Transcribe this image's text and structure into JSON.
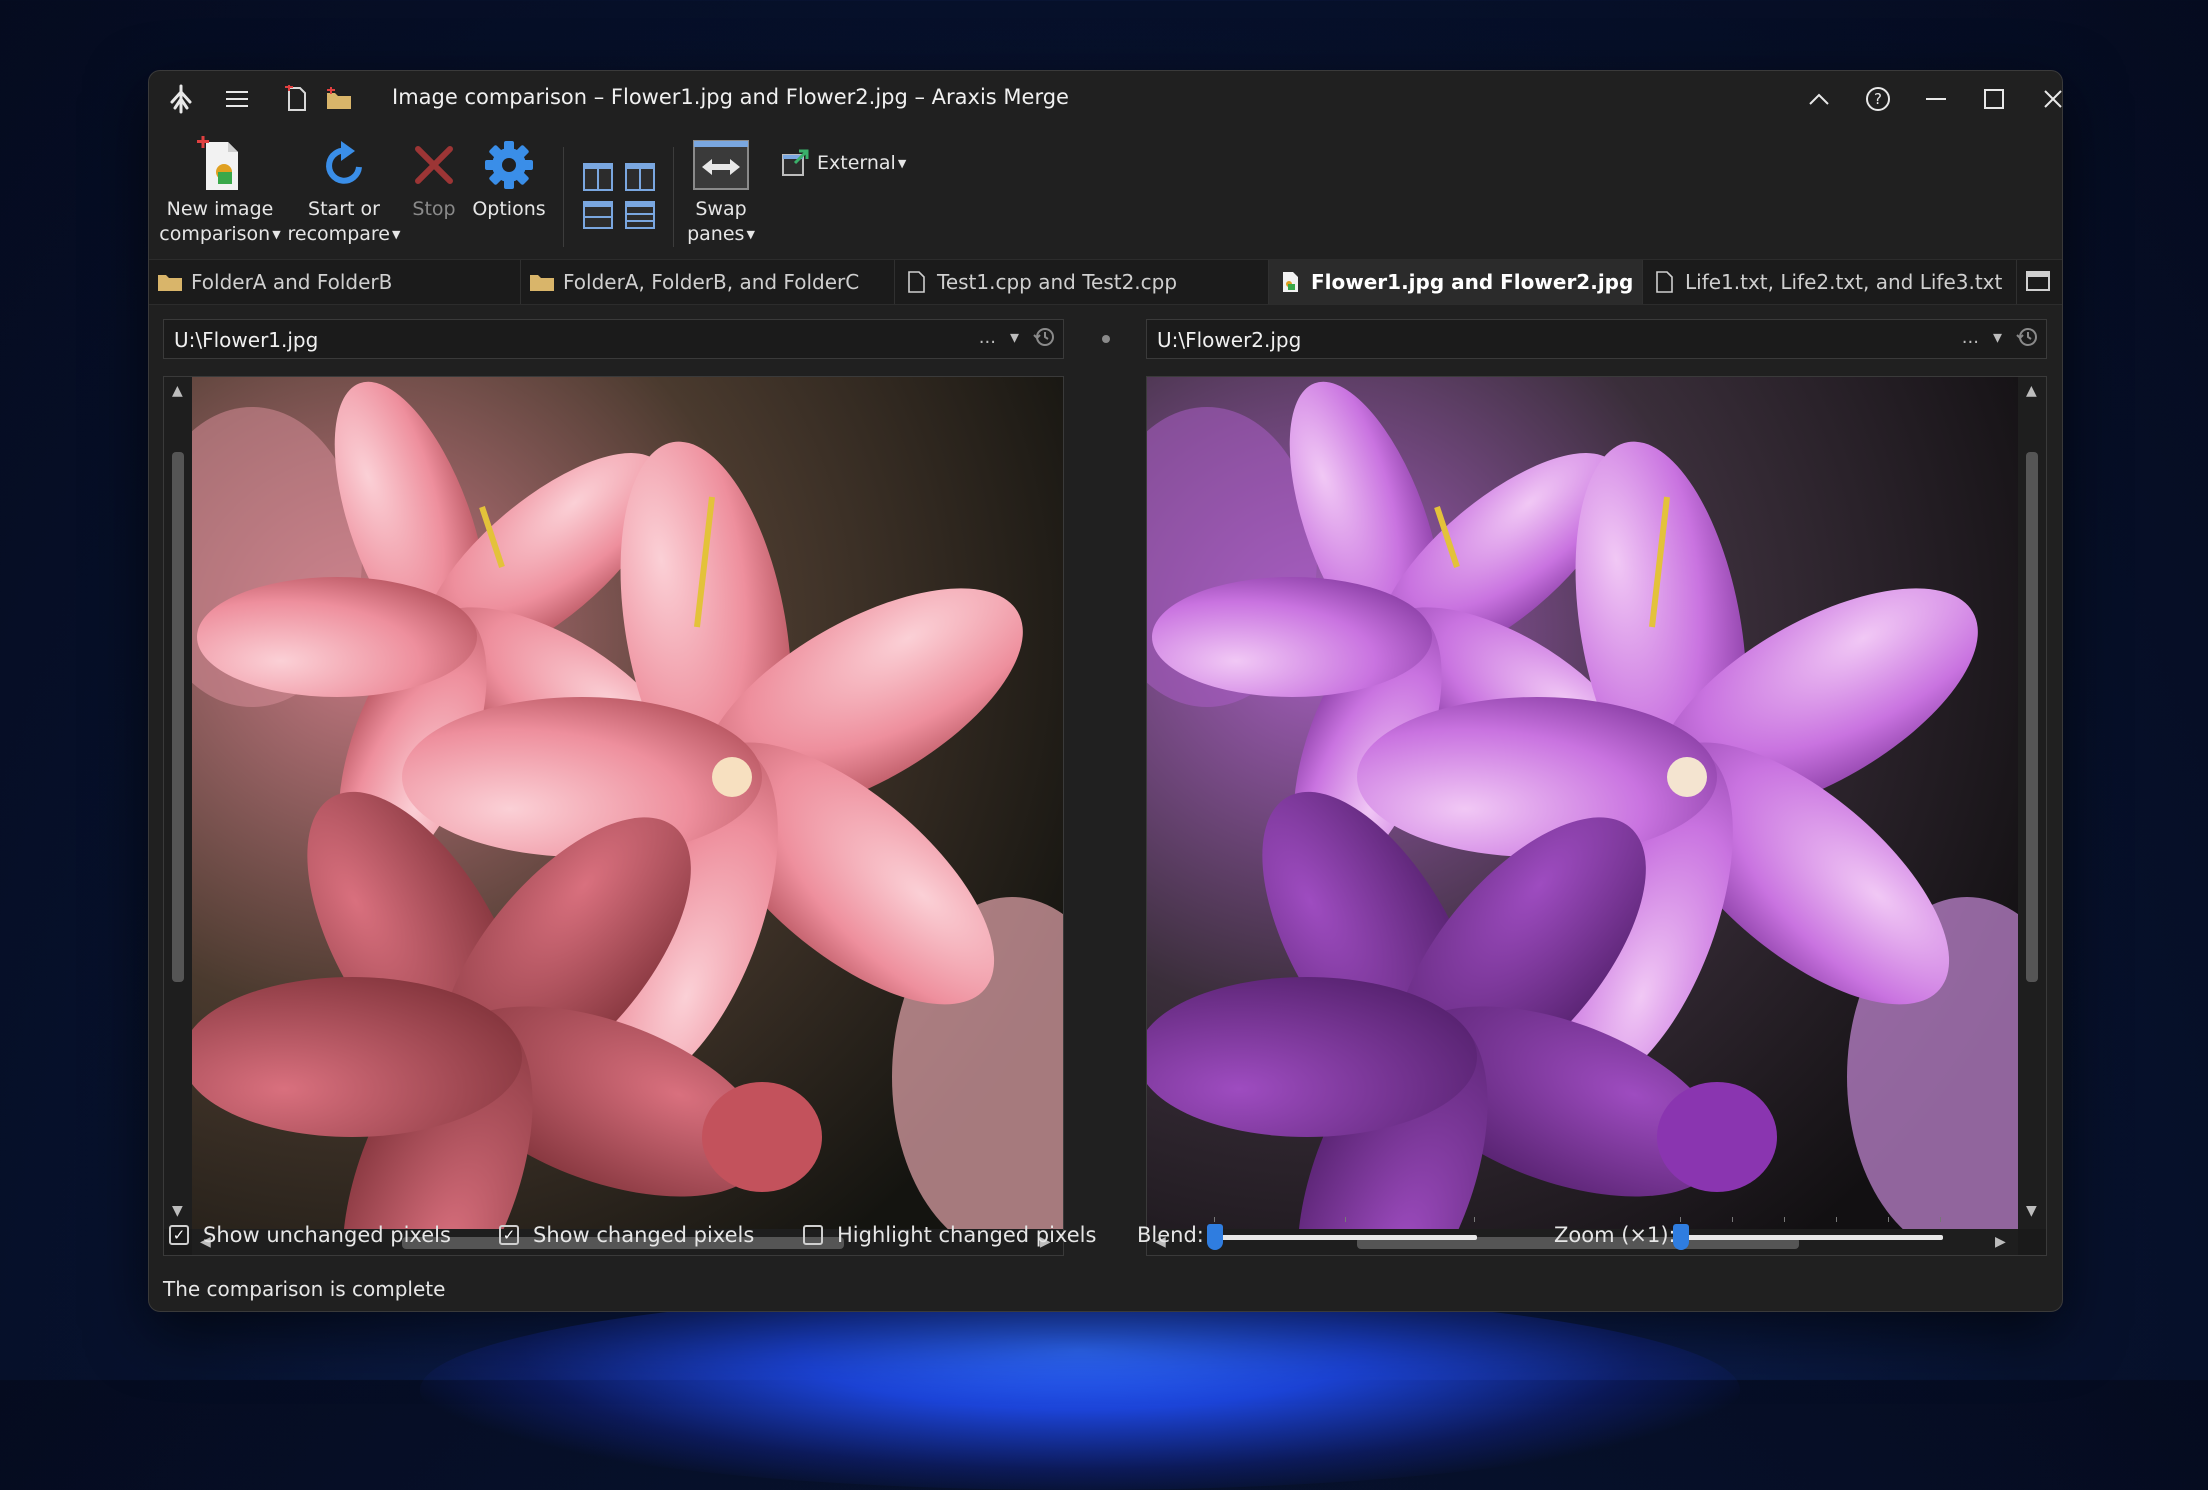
{
  "window": {
    "title": "Image comparison – Flower1.jpg and Flower2.jpg – Araxis Merge"
  },
  "titlebar_icons": [
    "app-logo-icon",
    "menu-icon",
    "new-file-icon",
    "open-folder-icon"
  ],
  "window_controls": [
    "collapse-ribbon-icon",
    "help-icon",
    "minimize-icon",
    "maximize-icon",
    "close-icon"
  ],
  "ribbon": {
    "new_image_comparison": {
      "line1": "New image",
      "line2": "comparison"
    },
    "start_or_recompare": {
      "line1": "Start or",
      "line2": "recompare"
    },
    "stop": "Stop",
    "options": "Options",
    "swap_panes": {
      "line1": "Swap",
      "line2": "panes"
    },
    "external": "External"
  },
  "tabs": [
    {
      "label": "FolderA and FolderB",
      "icon": "folder-icon",
      "active": false
    },
    {
      "label": "FolderA, FolderB, and FolderC",
      "icon": "folder-icon",
      "active": false
    },
    {
      "label": "Test1.cpp and Test2.cpp",
      "icon": "file-icon",
      "active": false
    },
    {
      "label": "Flower1.jpg and Flower2.jpg",
      "icon": "image-file-icon",
      "active": true
    },
    {
      "label": "Life1.txt, Life2.txt, and Life3.txt",
      "icon": "file-icon",
      "active": false
    }
  ],
  "left_pane": {
    "path": "U:\\Flower1.jpg",
    "tint": "#e88aa0"
  },
  "right_pane": {
    "path": "U:\\Flower2.jpg",
    "tint": "#b45ad0"
  },
  "path_controls": {
    "more": "...",
    "dropdown": "▾",
    "history": "history-icon"
  },
  "bottom": {
    "show_unchanged": {
      "label": "Show unchanged pixels",
      "checked": true
    },
    "show_changed": {
      "label": "Show changed pixels",
      "checked": true
    },
    "highlight_changed": {
      "label": "Highlight changed pixels",
      "checked": false
    },
    "blend_label": "Blend:",
    "blend_value": 0,
    "zoom_label": "Zoom (×1):",
    "zoom_value": 0
  },
  "status": "The comparison is complete",
  "colors": {
    "accent": "#2f7de0",
    "window_bg": "#202020",
    "stop_red": "#b03a3a",
    "refresh_blue": "#3a8ee8"
  }
}
